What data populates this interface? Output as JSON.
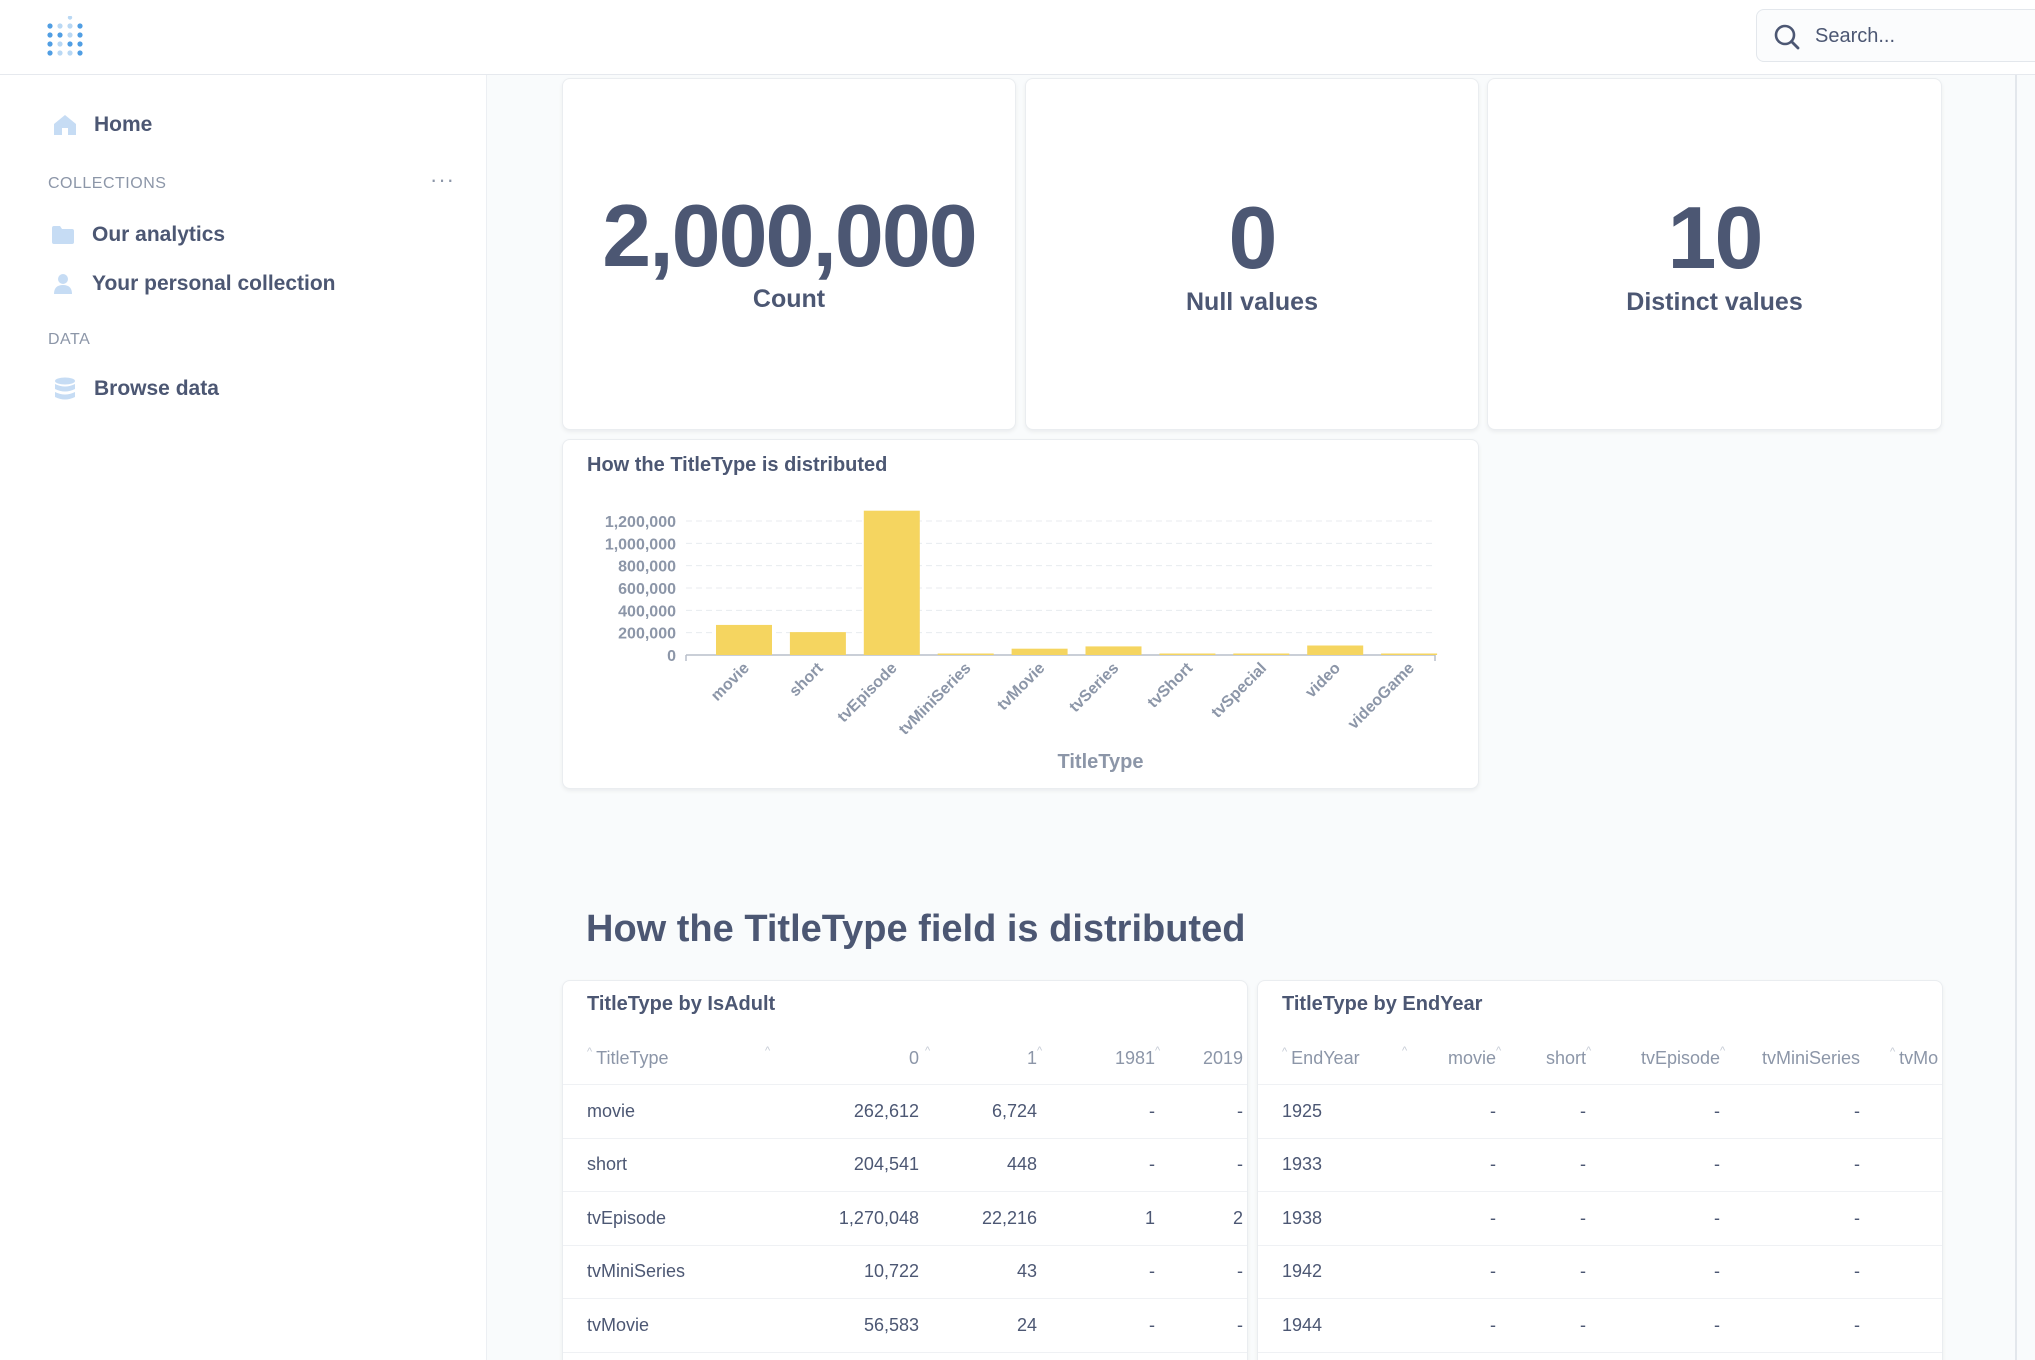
{
  "search": {
    "placeholder": "Search..."
  },
  "sidebar": {
    "home": "Home",
    "collections_label": "COLLECTIONS",
    "collections": [
      "Our analytics",
      "Your personal collection"
    ],
    "data_label": "DATA",
    "browse": "Browse data"
  },
  "scalars": [
    {
      "value": "2,000,000",
      "label": "Count"
    },
    {
      "value": "0",
      "label": "Null values"
    },
    {
      "value": "10",
      "label": "Distinct values"
    }
  ],
  "chart": {
    "title": "How the TitleType is distributed",
    "chart_data": {
      "type": "bar",
      "categories": [
        "movie",
        "short",
        "tvEpisode",
        "tvMiniSeries",
        "tvMovie",
        "tvSeries",
        "tvShort",
        "tvSpecial",
        "video",
        "videoGame"
      ],
      "values": [
        269336,
        204989,
        1292266,
        10765,
        56607,
        77000,
        6000,
        7000,
        85000,
        12000
      ],
      "xlabel": "TitleType",
      "ylabel": "",
      "ylim": [
        0,
        1300000
      ],
      "yticks": [
        "0",
        "200,000",
        "400,000",
        "600,000",
        "800,000",
        "1,000,000",
        "1,200,000"
      ],
      "grid": true,
      "color": "#f5d560"
    }
  },
  "section_heading": "How the TitleType field is distributed",
  "table1": {
    "title": "TitleType by IsAdult",
    "headers": [
      "TitleType",
      "0",
      "1",
      "1981",
      "2019"
    ],
    "rows": [
      [
        "movie",
        "262,612",
        "6,724",
        "-",
        "-"
      ],
      [
        "short",
        "204,541",
        "448",
        "-",
        "-"
      ],
      [
        "tvEpisode",
        "1,270,048",
        "22,216",
        "1",
        "2"
      ],
      [
        "tvMiniSeries",
        "10,722",
        "43",
        "-",
        "-"
      ],
      [
        "tvMovie",
        "56,583",
        "24",
        "-",
        "-"
      ]
    ]
  },
  "table2": {
    "title": "TitleType by EndYear",
    "headers": [
      "EndYear",
      "movie",
      "short",
      "tvEpisode",
      "tvMiniSeries",
      "tvMo"
    ],
    "rows": [
      [
        "1925",
        "-",
        "-",
        "-",
        "-"
      ],
      [
        "1933",
        "-",
        "-",
        "-",
        "-"
      ],
      [
        "1938",
        "-",
        "-",
        "-",
        "-"
      ],
      [
        "1942",
        "-",
        "-",
        "-",
        "-"
      ],
      [
        "1944",
        "-",
        "-",
        "-",
        "-"
      ]
    ]
  },
  "colors": {
    "accent": "#509ee3",
    "bar": "#f5d560",
    "text": "#4c5773",
    "muted": "#8c96a8"
  }
}
